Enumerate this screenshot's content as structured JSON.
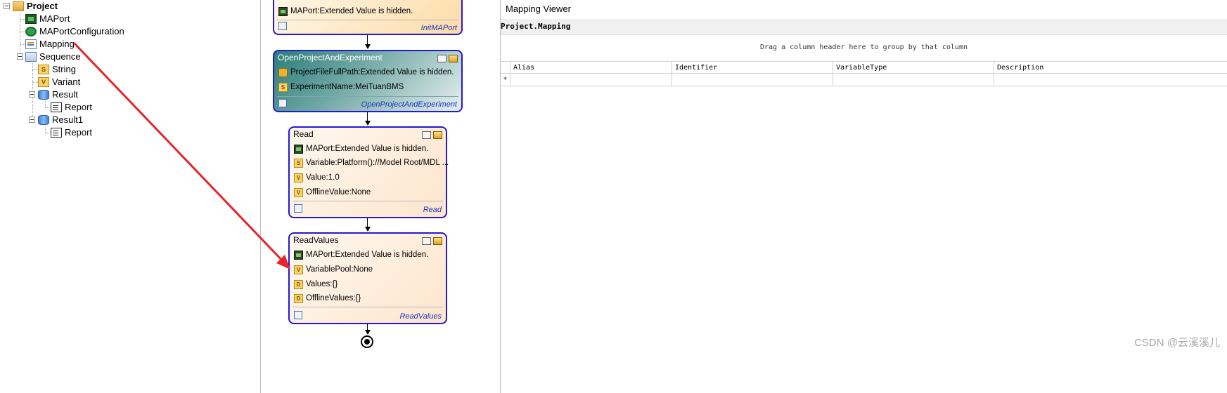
{
  "tree": {
    "root": "Project",
    "items": [
      {
        "label": "MAPort",
        "icon": "maport-board-icon"
      },
      {
        "label": "MAPortConfiguration",
        "icon": "configuration-gear-icon"
      },
      {
        "label": "Mapping",
        "icon": "mapping-table-icon"
      },
      {
        "label": "Sequence",
        "icon": "sequence-icon"
      },
      {
        "label": "String",
        "icon": "string-variable-icon"
      },
      {
        "label": "Variant",
        "icon": "variant-variable-icon"
      },
      {
        "label": "Result",
        "icon": "result-database-icon"
      },
      {
        "label": "Report",
        "icon": "report-document-icon"
      },
      {
        "label": "Result1",
        "icon": "result-database-icon"
      },
      {
        "label": "Report",
        "icon": "report-document-icon"
      }
    ]
  },
  "workflow": {
    "init": {
      "prop": "MAPort:Extended Value is hidden.",
      "footer": "InitMAPort"
    },
    "open": {
      "title": "OpenProjectAndExperiment",
      "props": [
        "ProjectFileFullPath:Extended Value is hidden.",
        "ExperimentName:MeiTuanBMS"
      ],
      "footer": "OpenProjectAndExperiment"
    },
    "read": {
      "title": "Read",
      "props": [
        "MAPort:Extended Value is hidden.",
        "Variable:Platform()://Model Root/MDL ...",
        "Value:1.0",
        "OfflineValue:None"
      ],
      "footer": "Read"
    },
    "readvalues": {
      "title": "ReadValues",
      "props": [
        "MAPort:Extended Value is hidden.",
        "VariablePool:None",
        "Values:{}",
        "OfflineValues:{}"
      ],
      "footer": "ReadValues"
    }
  },
  "viewer": {
    "title": "Mapping Viewer",
    "path": "Project.Mapping",
    "group_hint": "Drag a column header here to group by that column",
    "columns": [
      "Alias",
      "Identifier",
      "VariableType",
      "Description"
    ],
    "new_row_marker": "*"
  },
  "watermark": "CSDN @云溪溪儿",
  "colors": {
    "annotation_arrow": "#e8242a",
    "activity_border": "#2418d4",
    "footer_link": "#1a35c8"
  }
}
